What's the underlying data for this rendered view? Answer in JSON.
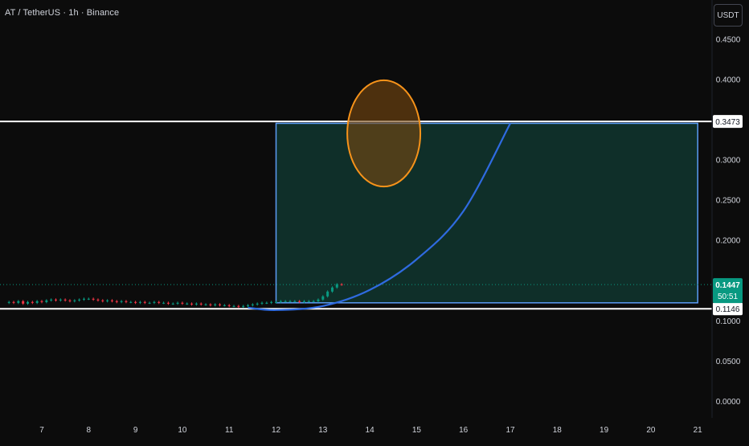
{
  "header": {
    "symbol_title": "AT / TetherUS · 1h · Binance",
    "currency_label": "USDT"
  },
  "colors": {
    "background": "#0c0c0c",
    "text": "#d1d4dc",
    "zone_fill": "#10322b",
    "zone_border": "#5b9cf5",
    "curve": "#2f6be0",
    "ellipse_stroke": "#f7931a",
    "ellipse_fill": "#7a4a10",
    "level_line": "#ffffff",
    "current_price": "#089981",
    "candle_up": "#089981",
    "candle_down": "#f23645"
  },
  "chart_data": {
    "type": "candlestick",
    "x_axis": {
      "tick_labels": [
        "7",
        "8",
        "9",
        "10",
        "11",
        "12",
        "13",
        "14",
        "15",
        "16",
        "17",
        "18",
        "19",
        "20",
        "21"
      ],
      "range": [
        6.3,
        21.1
      ]
    },
    "y_axis": {
      "tick_labels": [
        "0.4500",
        "0.4000",
        "0.3000",
        "0.2500",
        "0.2000",
        "0.1000",
        "0.0500",
        "0.0000"
      ],
      "tick_values": [
        0.45,
        0.4,
        0.3,
        0.25,
        0.2,
        0.1,
        0.05,
        0.0
      ],
      "range": [
        0.0,
        0.47
      ]
    },
    "horizontal_levels": [
      {
        "value": 0.3473,
        "label": "0.3473"
      },
      {
        "value": 0.1146,
        "label": "0.1146"
      }
    ],
    "current_price": {
      "value": 0.1447,
      "label": "0.1447",
      "countdown": "50:51"
    },
    "target_zone": {
      "x_start": 12.0,
      "x_end": 21.0,
      "y_low": 0.122,
      "y_high": 0.345
    },
    "curve_points": [
      [
        11.4,
        0.116
      ],
      [
        12.0,
        0.113
      ],
      [
        13.0,
        0.118
      ],
      [
        14.0,
        0.138
      ],
      [
        15.0,
        0.176
      ],
      [
        16.0,
        0.236
      ],
      [
        17.0,
        0.345
      ]
    ],
    "highlight_ellipse": {
      "cx": 14.3,
      "cy": 0.3325,
      "rx": 0.78,
      "ry": 0.066
    },
    "price_series": {
      "x_start": 6.3,
      "x_end": 12.65,
      "step": 0.1,
      "closes": [
        0.123,
        0.122,
        0.124,
        0.121,
        0.123,
        0.122,
        0.124,
        0.123,
        0.125,
        0.126,
        0.125,
        0.126,
        0.125,
        0.124,
        0.125,
        0.126,
        0.127,
        0.127,
        0.126,
        0.125,
        0.124,
        0.125,
        0.124,
        0.123,
        0.124,
        0.123,
        0.123,
        0.122,
        0.123,
        0.122,
        0.122,
        0.123,
        0.122,
        0.122,
        0.121,
        0.121,
        0.122,
        0.121,
        0.121,
        0.12,
        0.121,
        0.12,
        0.12,
        0.119,
        0.12,
        0.119,
        0.119,
        0.118,
        0.118,
        0.117,
        0.118,
        0.119,
        0.12,
        0.121,
        0.122,
        0.122,
        0.123,
        0.123,
        0.124,
        0.124,
        0.124,
        0.124,
        0.123,
        0.124,
        0.124,
        0.124,
        0.126,
        0.13,
        0.136,
        0.141,
        0.145,
        0.1447
      ]
    }
  }
}
